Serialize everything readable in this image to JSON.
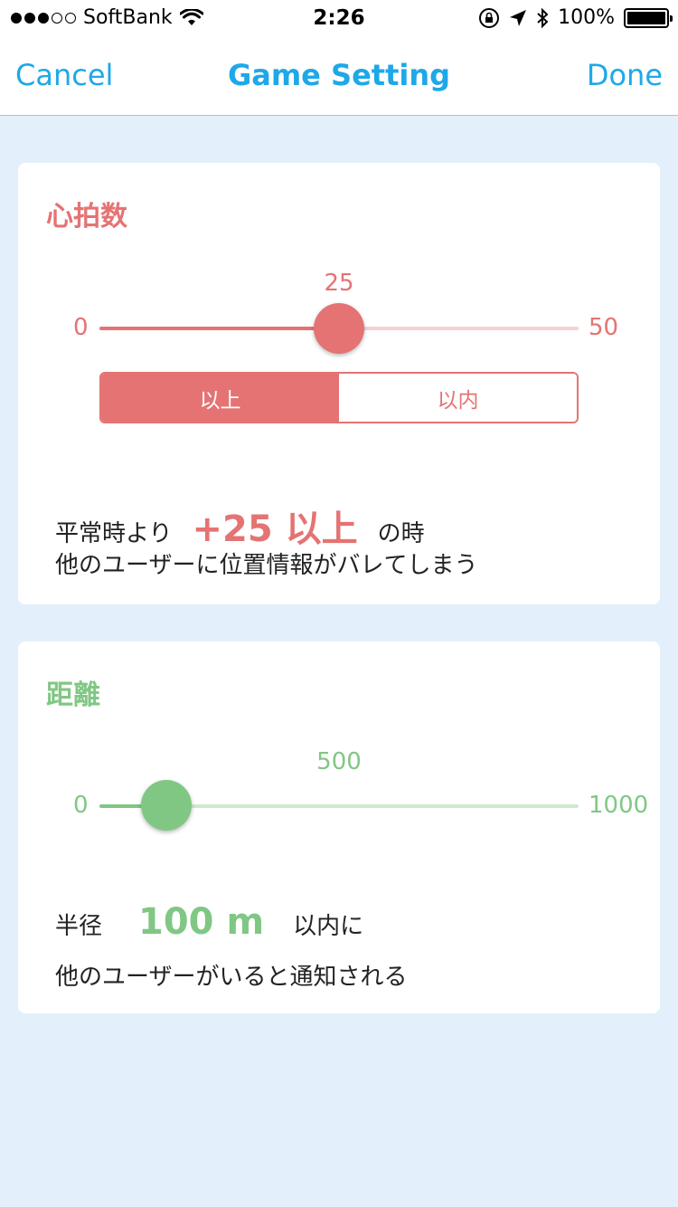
{
  "status_bar": {
    "carrier": "SoftBank",
    "time": "2:26",
    "battery": "100%",
    "signal_bars_filled": 3,
    "signal_bars_total": 5
  },
  "nav": {
    "cancel_label": "Cancel",
    "title": "Game Setting",
    "done_label": "Done"
  },
  "heart": {
    "title": "心拍数",
    "min": "0",
    "max": "50",
    "value": "25",
    "value_fraction": 0.5,
    "segments": [
      "以上",
      "以内"
    ],
    "selected_segment": "以上",
    "desc_prefix": "平常時より",
    "desc_value": "+25 以上",
    "desc_suffix": "の時",
    "desc_line2": "他のユーザーに位置情報がバレてしまう",
    "color": "#e57373"
  },
  "distance": {
    "title": "距離",
    "min": "0",
    "max": "1000",
    "value": "500",
    "value_fraction": 0.14,
    "desc_prefix": "半径",
    "desc_value": "100 m",
    "desc_suffix": "以内に",
    "desc_line2": "他のユーザーがいると通知される",
    "color": "#81c784"
  },
  "colors": {
    "accent": "#1ea8e8",
    "background": "#e3f0fb"
  }
}
